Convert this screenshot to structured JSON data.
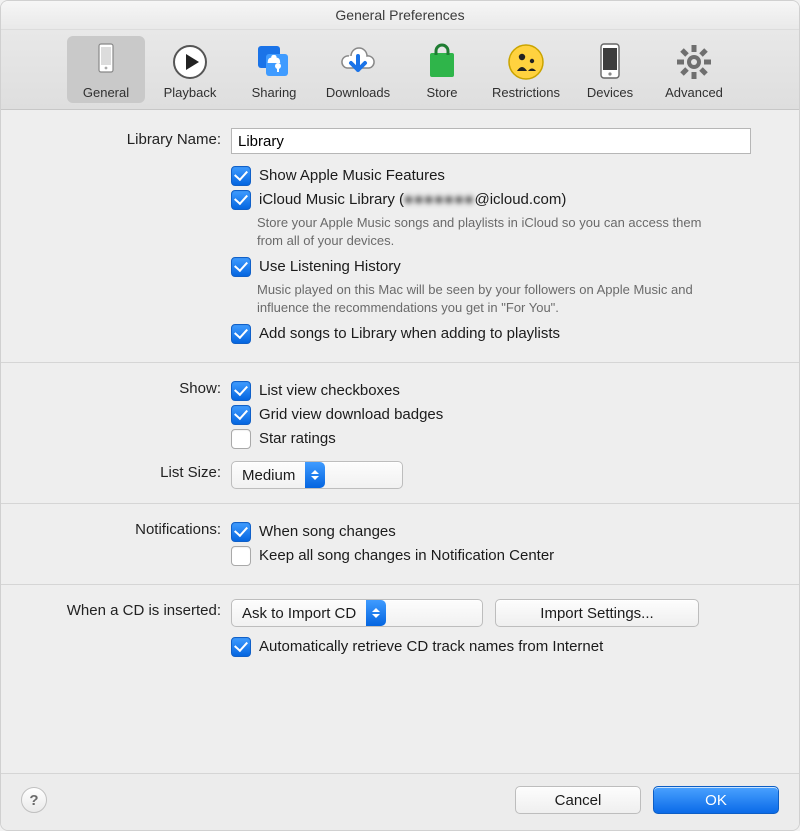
{
  "title": "General Preferences",
  "toolbar": [
    {
      "label": "General",
      "icon": "device-phone-icon",
      "selected": true
    },
    {
      "label": "Playback",
      "icon": "play-icon"
    },
    {
      "label": "Sharing",
      "icon": "sharing-icon"
    },
    {
      "label": "Downloads",
      "icon": "download-cloud-icon"
    },
    {
      "label": "Store",
      "icon": "bag-icon"
    },
    {
      "label": "Restrictions",
      "icon": "parental-icon"
    },
    {
      "label": "Devices",
      "icon": "device-icon"
    },
    {
      "label": "Advanced",
      "icon": "gear-icon"
    }
  ],
  "library": {
    "name_label": "Library Name:",
    "name_value": "Library",
    "show_apple_music": {
      "checked": true,
      "label": "Show Apple Music Features"
    },
    "icloud_library": {
      "checked": true,
      "label": "iCloud Music Library (",
      "account_hidden": "●●●●●●●",
      "account_suffix": "@icloud.com)",
      "desc": "Store your Apple Music songs and playlists in iCloud so you can access them from all of your devices."
    },
    "listening_history": {
      "checked": true,
      "label": "Use Listening History",
      "desc": "Music played on this Mac will be seen by your followers on Apple Music and influence the recommendations you get in \"For You\"."
    },
    "add_to_library": {
      "checked": true,
      "label": "Add songs to Library when adding to playlists"
    }
  },
  "show": {
    "label": "Show:",
    "list_checkboxes": {
      "checked": true,
      "label": "List view checkboxes"
    },
    "grid_badges": {
      "checked": true,
      "label": "Grid view download badges"
    },
    "star_ratings": {
      "checked": false,
      "label": "Star ratings"
    }
  },
  "list_size": {
    "label": "List Size:",
    "value": "Medium"
  },
  "notifications": {
    "label": "Notifications:",
    "song_changes": {
      "checked": true,
      "label": "When song changes"
    },
    "keep_all": {
      "checked": false,
      "label": "Keep all song changes in Notification Center"
    }
  },
  "cd": {
    "label": "When a CD is inserted:",
    "action": "Ask to Import CD",
    "import_settings": "Import Settings...",
    "auto_track_names": {
      "checked": true,
      "label": "Automatically retrieve CD track names from Internet"
    }
  },
  "footer": {
    "help": "?",
    "cancel": "Cancel",
    "ok": "OK"
  }
}
